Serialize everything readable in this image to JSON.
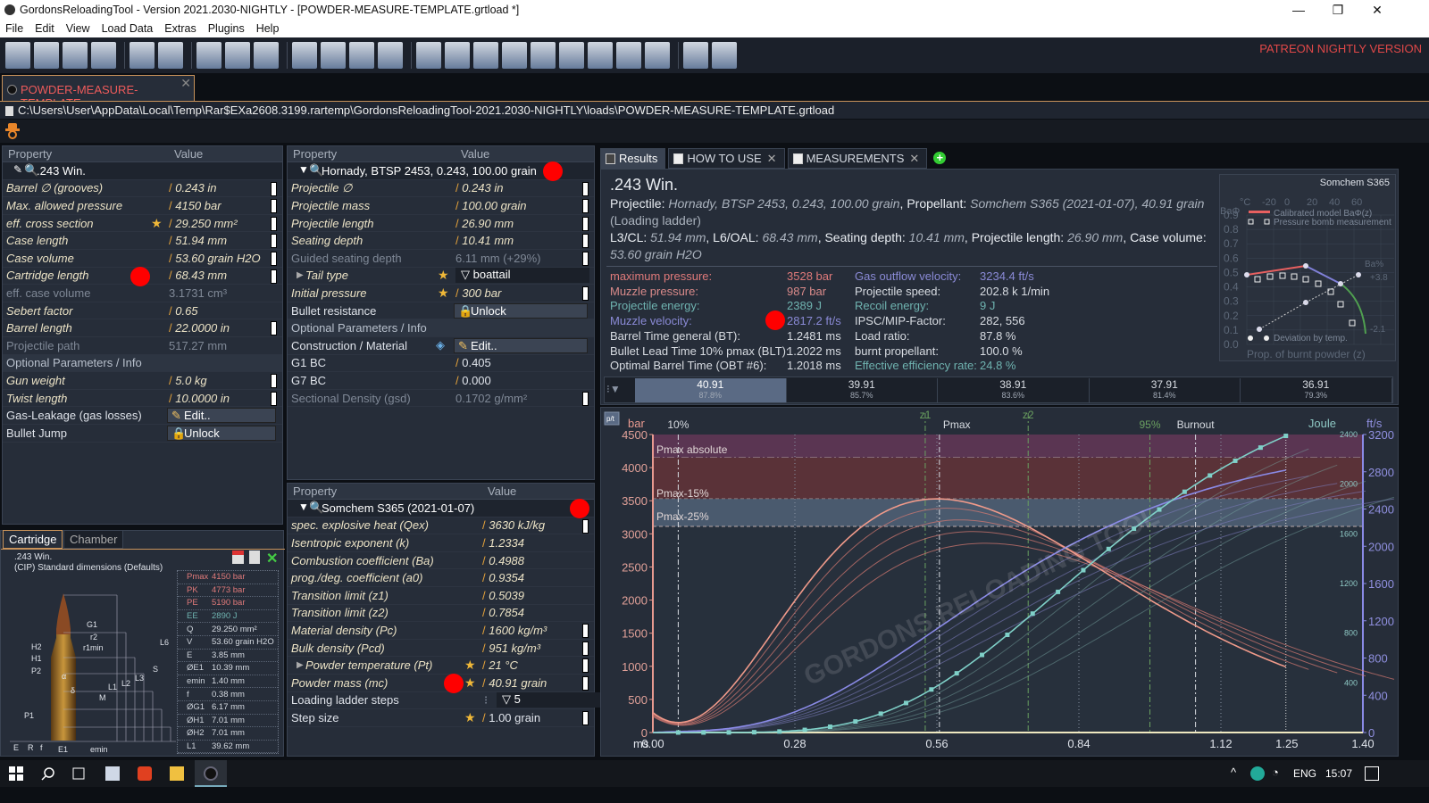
{
  "window": {
    "title": "GordonsReloadingTool - Version 2021.2030-NIGHTLY - [POWDER-MEASURE-TEMPLATE.grtload *]",
    "min": "—",
    "max": "❐",
    "close": "✕"
  },
  "menu": [
    "File",
    "Edit",
    "View",
    "Load Data",
    "Extras",
    "Plugins",
    "Help"
  ],
  "toolbar": {
    "groups": [
      4,
      2,
      3,
      4,
      9,
      2
    ],
    "patreon": "PATREON NIGHTLY VERSION"
  },
  "doc_tab": {
    "label": "POWDER-MEASURE-TEMPLATE",
    "close": "✕"
  },
  "path": "C:\\Users\\User\\AppData\\Local\\Temp\\Rar$EXa2608.3199.rartemp\\GordonsReloadingTool-2021.2030-NIGHTLY\\loads\\POWDER-MEASURE-TEMPLATE.grtload",
  "cartridge_grid": {
    "header": {
      "property": "Property",
      "value": "Value"
    },
    "rows": [
      {
        "type": "group",
        "label": ".243 Win."
      },
      {
        "label": "Barrel ∅ (grooves)",
        "value": "0.243 in",
        "scroll": true
      },
      {
        "label": "Max. allowed pressure",
        "value": "4150 bar",
        "scroll": true
      },
      {
        "label": "eff. cross section",
        "value": "29.250 mm²",
        "star": true,
        "scroll": true
      },
      {
        "label": "Case length",
        "value": "51.94 mm",
        "scroll": true
      },
      {
        "label": "Case volume",
        "value": "53.60 grain H2O",
        "scroll": true
      },
      {
        "label": "Cartridge length",
        "value": "68.43 mm",
        "scroll": true,
        "marker": true
      },
      {
        "type": "grey",
        "label": "eff. case volume",
        "value": "3.1731 cm³"
      },
      {
        "label": "Sebert factor",
        "value": "0.65"
      },
      {
        "label": "Barrel length",
        "value": "22.0000 in",
        "scroll": true
      },
      {
        "type": "grey",
        "label": "Projectile path",
        "value": "517.27 mm"
      },
      {
        "type": "section",
        "label": "Optional Parameters / Info"
      },
      {
        "label": "Gun weight",
        "value": "5.0 kg",
        "scroll": true
      },
      {
        "label": "Twist length",
        "value": "10.0000 in",
        "scroll": true
      },
      {
        "type": "button",
        "label": "Gas-Leakage (gas losses)",
        "value": "Edit..",
        "icon": "✎"
      },
      {
        "type": "button",
        "label": "Bullet Jump",
        "value": "Unlock",
        "icon": "🔒"
      }
    ]
  },
  "projectile_grid": {
    "header": {
      "property": "Property",
      "value": "Value"
    },
    "rows": [
      {
        "type": "group",
        "label": "Hornady, BTSP 2453, 0.243, 100.00 grain",
        "marker": true
      },
      {
        "label": "Projectile ∅",
        "value": "0.243 in",
        "scroll": true
      },
      {
        "label": "Projectile mass",
        "value": "100.00 grain",
        "scroll": true
      },
      {
        "label": "Projectile length",
        "value": "26.90 mm",
        "scroll": true
      },
      {
        "label": "Seating depth",
        "value": "10.41 mm",
        "scroll": true
      },
      {
        "type": "grey",
        "label": "Guided seating depth",
        "value": "6.11 mm (+29%)",
        "scroll": true
      },
      {
        "type": "dropdown",
        "label": "Tail type",
        "value": "boattail",
        "star": true,
        "expander": true
      },
      {
        "label": "Initial pressure",
        "value": "300 bar",
        "star": true,
        "scroll": true
      },
      {
        "type": "button",
        "label": "Bullet resistance",
        "value": "Unlock",
        "icon": "🔒"
      },
      {
        "type": "section",
        "label": "Optional Parameters / Info"
      },
      {
        "type": "button",
        "label": "Construction / Material",
        "value": "Edit..",
        "icon": "✎",
        "diamond": true
      },
      {
        "type": "plainval",
        "label": "G1 BC",
        "value": "0.405"
      },
      {
        "type": "plainval",
        "label": "G7 BC",
        "value": "0.000"
      },
      {
        "type": "grey",
        "label": "Sectional Density (gsd)",
        "value": "0.1702 g/mm²",
        "scroll": true
      }
    ]
  },
  "propellant_grid": {
    "header": {
      "property": "Property",
      "value": "Value"
    },
    "rows": [
      {
        "type": "group",
        "label": "Somchem S365 (2021-01-07)",
        "marker": true
      },
      {
        "label": "spec. explosive heat (Qex)",
        "value": "3630 kJ/kg",
        "scroll": true
      },
      {
        "label": "Isentropic exponent (k)",
        "value": "1.2334"
      },
      {
        "label": "Combustion coefficient (Ba)",
        "value": "0.4988"
      },
      {
        "label": "prog./deg. coefficient (a0)",
        "value": "0.9354"
      },
      {
        "label": "Transition limit (z1)",
        "value": "0.5039"
      },
      {
        "label": "Transition limit (z2)",
        "value": "0.7854"
      },
      {
        "label": "Material density (Pc)",
        "value": "1600 kg/m³",
        "scroll": true
      },
      {
        "label": "Bulk density (Pcd)",
        "value": "951 kg/m³",
        "scroll": true
      },
      {
        "label": "Powder temperature (Pt)",
        "value": "21 °C",
        "star": true,
        "scroll": true,
        "expander": true
      },
      {
        "label": "Powder mass (mc)",
        "value": "40.91 grain",
        "star": true,
        "scroll": true,
        "marker": true
      },
      {
        "type": "dropdown",
        "label": "Loading ladder steps",
        "value": "5",
        "plain": true
      },
      {
        "label": "Step size",
        "value": "1.00 grain",
        "star": true,
        "scroll": true,
        "plain": true
      }
    ]
  },
  "cartridge_panel": {
    "tabs": [
      "Cartridge",
      "Chamber"
    ],
    "name": ".243 Win.",
    "standard": "(CIP) Standard dimensions (Defaults)",
    "dims": [
      {
        "k": "Pmax",
        "v": "4150 bar",
        "color": "#e07a7a"
      },
      {
        "k": "PK",
        "v": "4773 bar",
        "color": "#e07a7a"
      },
      {
        "k": "PE",
        "v": "5190 bar",
        "color": "#e07a7a"
      },
      {
        "k": "EE",
        "v": "2890 J",
        "color": "#6fb3b0"
      },
      {
        "k": "Q",
        "v": "29.250 mm²"
      },
      {
        "k": "V",
        "v": "53.60 grain H2O"
      },
      {
        "k": "E",
        "v": "3.85 mm"
      },
      {
        "k": "ØE1",
        "v": "10.39 mm"
      },
      {
        "k": "emin",
        "v": "1.40 mm"
      },
      {
        "k": "f",
        "v": "0.38 mm"
      },
      {
        "k": "ØG1",
        "v": "6.17 mm"
      },
      {
        "k": "ØH1",
        "v": "7.01 mm"
      },
      {
        "k": "ØH2",
        "v": "7.01 mm"
      },
      {
        "k": "L1",
        "v": "39.62 mm"
      }
    ],
    "drawing_labels": [
      "G1",
      "r2",
      "r1min",
      "H2",
      "H1",
      "P2",
      "α",
      "L6",
      "S",
      "L3",
      "L2",
      "L1",
      "M",
      "δ",
      "P1",
      "E",
      "R",
      "f",
      "E1",
      "emin"
    ]
  },
  "results": {
    "tabs": [
      {
        "label": "Results"
      },
      {
        "label": "HOW TO USE",
        "close": "✕"
      },
      {
        "label": "MEASUREMENTS",
        "close": "✕"
      }
    ],
    "add": "+",
    "title": ".243 Win.",
    "line1": {
      "projectile_label": "Projectile:",
      "projectile": "Hornady, BTSP 2453, 0.243, 100.00 grain",
      "propellant_label": "Propellant:",
      "propellant": "Somchem S365 (2021-01-07), 40.91 grain"
    },
    "line2": "(Loading ladder)",
    "line3": {
      "l3": "L3/CL:",
      "l3v": "51.94 mm",
      "l6": "L6/OAL:",
      "l6v": "68.43 mm",
      "sd": "Seating depth:",
      "sdv": "10.41 mm",
      "pl": "Projectile length:",
      "plv": "26.90 mm",
      "cv": "Case volume:",
      "cvv": "53.60 grain H2O"
    },
    "stats_left": [
      {
        "label": "maximum pressure:",
        "value": "3528 bar",
        "color": "#e07a7a"
      },
      {
        "label": "Muzzle pressure:",
        "value": "987 bar",
        "color": "#d98a8a"
      },
      {
        "label": "Projectile energy:",
        "value": "2389 J",
        "color": "#6fb3b0"
      },
      {
        "label": "Muzzle velocity:",
        "value": "2817.2 ft/s",
        "color": "#8a8ad6"
      },
      {
        "label": "Barrel Time general (BT):",
        "value": "1.2481 ms",
        "color": "#d8dce2"
      },
      {
        "label": "Bullet Lead Time 10% pmax (BLT):",
        "value": "1.2022 ms",
        "color": "#d8dce2"
      },
      {
        "label": "Optimal Barrel Time (OBT #6):",
        "value": "1.2018 ms",
        "color": "#d8dce2"
      }
    ],
    "stats_right": [
      {
        "label": "Gas outflow velocity:",
        "value": "3234.4 ft/s",
        "color": "#8a8ad6"
      },
      {
        "label": "Projectile speed:",
        "value": "202.8 k 1/min",
        "color": "#d8dce2"
      },
      {
        "label": "Recoil energy:",
        "value": "9 J",
        "color": "#6fb3b0"
      },
      {
        "label": "IPSC/MIP-Factor:",
        "value": "282, 556",
        "color": "#d8dce2"
      },
      {
        "label": "Load ratio:",
        "value": "87.8 %",
        "color": "#d8dce2"
      },
      {
        "label": "burnt propellant:",
        "value": "100.0 %",
        "color": "#d8dce2"
      },
      {
        "label": "Effective efficiency rate:",
        "value": "24.8 %",
        "color": "#6fb3b0"
      }
    ],
    "mini_chart": {
      "title": "Somchem S365",
      "y_label": "BaΦ",
      "right_label": "Ba%",
      "right_values": [
        "+3.8",
        "-2.1"
      ],
      "top_axis": [
        "°C",
        "-20",
        "0",
        "20",
        "40",
        "60"
      ],
      "y_ticks": [
        "0.0",
        "0.1",
        "0.2",
        "0.3",
        "0.4",
        "0.5",
        "0.6",
        "0.7",
        "0.8",
        "0.9"
      ],
      "legend": [
        "Calibrated model BaΦ(z)",
        "Pressure bomb measurement",
        "Deviation by temp."
      ],
      "x_label": "Prop. of burnt powder (z)"
    }
  },
  "ladder": [
    {
      "charge": "40.91",
      "ratio": "87.8%",
      "selected": true
    },
    {
      "charge": "39.91",
      "ratio": "85.7%"
    },
    {
      "charge": "38.91",
      "ratio": "83.6%"
    },
    {
      "charge": "37.91",
      "ratio": "81.4%"
    },
    {
      "charge": "36.91",
      "ratio": "79.3%"
    }
  ],
  "chart_data": {
    "type": "line",
    "toggle": "p/t",
    "x_unit": "ms",
    "x_ticks": [
      "0.00",
      "0.28",
      "0.56",
      "0.84",
      "1.12",
      "1.25",
      "1.40"
    ],
    "xlim": [
      0,
      1.4
    ],
    "y_left": {
      "label": "bar",
      "ticks": [
        0,
        500,
        1000,
        1500,
        2000,
        2500,
        3000,
        3500,
        4000,
        4500
      ],
      "lim": [
        0,
        4500
      ]
    },
    "y_joule": {
      "label": "Joule",
      "ticks": [
        400,
        800,
        1200,
        1600,
        2000,
        2400
      ],
      "lim": [
        0,
        2400
      ]
    },
    "y_fts": {
      "label": "ft/s",
      "ticks": [
        0,
        400,
        800,
        1200,
        1600,
        2000,
        2400,
        2800,
        3200
      ],
      "lim": [
        0,
        3200
      ]
    },
    "bands": [
      {
        "label": "Pmax absolute",
        "from": 4150,
        "to": 4500,
        "color": "#5a3552"
      },
      {
        "label": "Pmax-15%",
        "from": 3528,
        "to": 4150,
        "color": "#5a3238"
      },
      {
        "label": "Pmax-25%",
        "from": 3113,
        "to": 3528,
        "color": "#4a5a6e"
      }
    ],
    "markers": [
      {
        "label": "10%",
        "t": 0.05,
        "color": "#d8dce2"
      },
      {
        "label": "z1",
        "t": 0.537,
        "color": "#6aa060"
      },
      {
        "label": "Pmax",
        "t": 0.565,
        "color": "#d8dce2"
      },
      {
        "label": "z2",
        "t": 0.74,
        "color": "#6aa060"
      },
      {
        "label": "95%",
        "t": 0.98,
        "color": "#6aa060"
      },
      {
        "label": "Burnout",
        "t": 1.07,
        "color": "#d8dce2"
      }
    ],
    "barrel_time": 1.2481,
    "series": [
      {
        "name": "pressure",
        "unit": "bar",
        "peak": 3528,
        "peak_t": 0.56,
        "muzzle": 987,
        "initial": 300,
        "color": "#f09a8a"
      },
      {
        "name": "velocity",
        "unit": "ft/s",
        "muzzle": 2817.2,
        "color": "#8a8ae6"
      },
      {
        "name": "energy",
        "unit": "J",
        "muzzle": 2389,
        "color": "#7fd0c8"
      }
    ],
    "ladder_scales": [
      0.96,
      0.91,
      0.86,
      0.81
    ]
  },
  "taskbar": {
    "lang": "ENG",
    "time": "15:07"
  }
}
